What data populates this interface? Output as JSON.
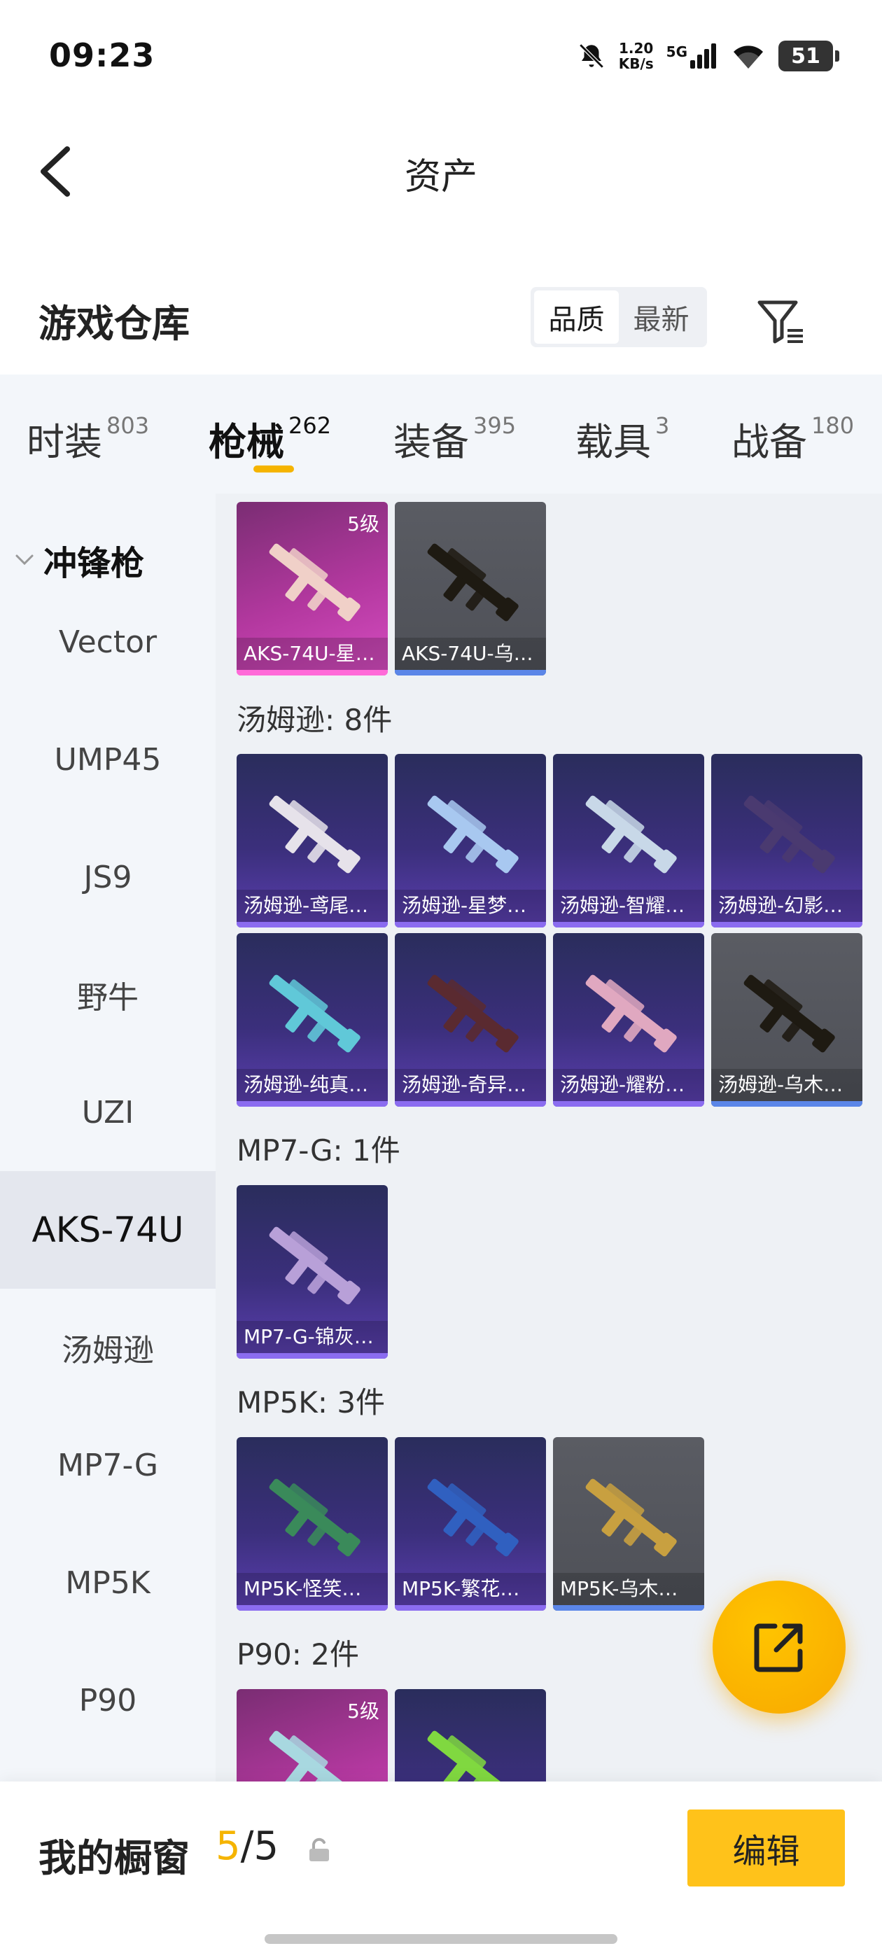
{
  "status": {
    "time": "09:23",
    "speed_value": "1.20",
    "speed_unit": "KB/s",
    "network": "5G",
    "battery": "51"
  },
  "header": {
    "title": "资产"
  },
  "warehouse": {
    "title": "游戏仓库",
    "sort_options": [
      {
        "label": "品质"
      },
      {
        "label": "最新"
      }
    ],
    "active_sort": "品质"
  },
  "categories": [
    {
      "name": "时装",
      "count": "803"
    },
    {
      "name": "枪械",
      "count": "262",
      "active": true
    },
    {
      "name": "装备",
      "count": "395"
    },
    {
      "name": "载具",
      "count": "3"
    },
    {
      "name": "战备",
      "count": "180"
    }
  ],
  "sidebar": {
    "group": "冲锋枪",
    "items": [
      {
        "label": "Vector"
      },
      {
        "label": "UMP45"
      },
      {
        "label": "JS9"
      },
      {
        "label": "野牛"
      },
      {
        "label": "UZI"
      },
      {
        "label": "AKS-74U",
        "active": true
      },
      {
        "label": "汤姆逊"
      },
      {
        "label": "MP7-G"
      },
      {
        "label": "MP5K"
      },
      {
        "label": "P90"
      }
    ]
  },
  "sections": [
    {
      "title": "",
      "items": [
        {
          "label": "AKS-74U-星…",
          "rarity": "pink",
          "level": "5级",
          "gun_color": "#f0d0c8"
        },
        {
          "label": "AKS-74U-乌…",
          "rarity": "gray",
          "gun_color": "#1e1a12"
        }
      ]
    },
    {
      "title": "汤姆逊: 8件",
      "items": [
        {
          "label": "汤姆逊-鸢尾…",
          "rarity": "purple",
          "gun_color": "#e6e2ea"
        },
        {
          "label": "汤姆逊-星梦…",
          "rarity": "purple",
          "gun_color": "#a8c8f0"
        },
        {
          "label": "汤姆逊-智耀…",
          "rarity": "purple",
          "gun_color": "#c8d8e8"
        },
        {
          "label": "汤姆逊-幻影…",
          "rarity": "purple",
          "gun_color": "#4a3a70"
        },
        {
          "label": "汤姆逊-纯真…",
          "rarity": "purple",
          "gun_color": "#60c8d8"
        },
        {
          "label": "汤姆逊-奇异…",
          "rarity": "purple",
          "gun_color": "#5a2a30"
        },
        {
          "label": "汤姆逊-耀粉…",
          "rarity": "purple",
          "gun_color": "#e0a8c0"
        },
        {
          "label": "汤姆逊-乌木…",
          "rarity": "gray",
          "gun_color": "#1e1a12"
        }
      ]
    },
    {
      "title": "MP7-G: 1件",
      "items": [
        {
          "label": "MP7-G-锦灰…",
          "rarity": "purple",
          "gun_color": "#b8a0d8"
        }
      ]
    },
    {
      "title": "MP5K: 3件",
      "items": [
        {
          "label": "MP5K-怪笑…",
          "rarity": "purple",
          "gun_color": "#3a8a5a"
        },
        {
          "label": "MP5K-繁花…",
          "rarity": "purple",
          "gun_color": "#3060c0"
        },
        {
          "label": "MP5K-乌木…",
          "rarity": "gray",
          "gun_color": "#c8a040"
        }
      ]
    },
    {
      "title": "P90: 2件",
      "items": [
        {
          "label": "",
          "rarity": "pink",
          "level": "5级",
          "gun_color": "#a8d8e0"
        },
        {
          "label": "",
          "rarity": "purple",
          "gun_color": "#80d840"
        }
      ]
    }
  ],
  "showcase": {
    "label": "我的橱窗",
    "current": "5",
    "separator": "/",
    "total": "5",
    "edit_label": "编辑"
  },
  "colors": {
    "accent": "#f5b400",
    "pink_rarity": "#d64dc1",
    "purple_rarity": "#5b3fb0"
  }
}
